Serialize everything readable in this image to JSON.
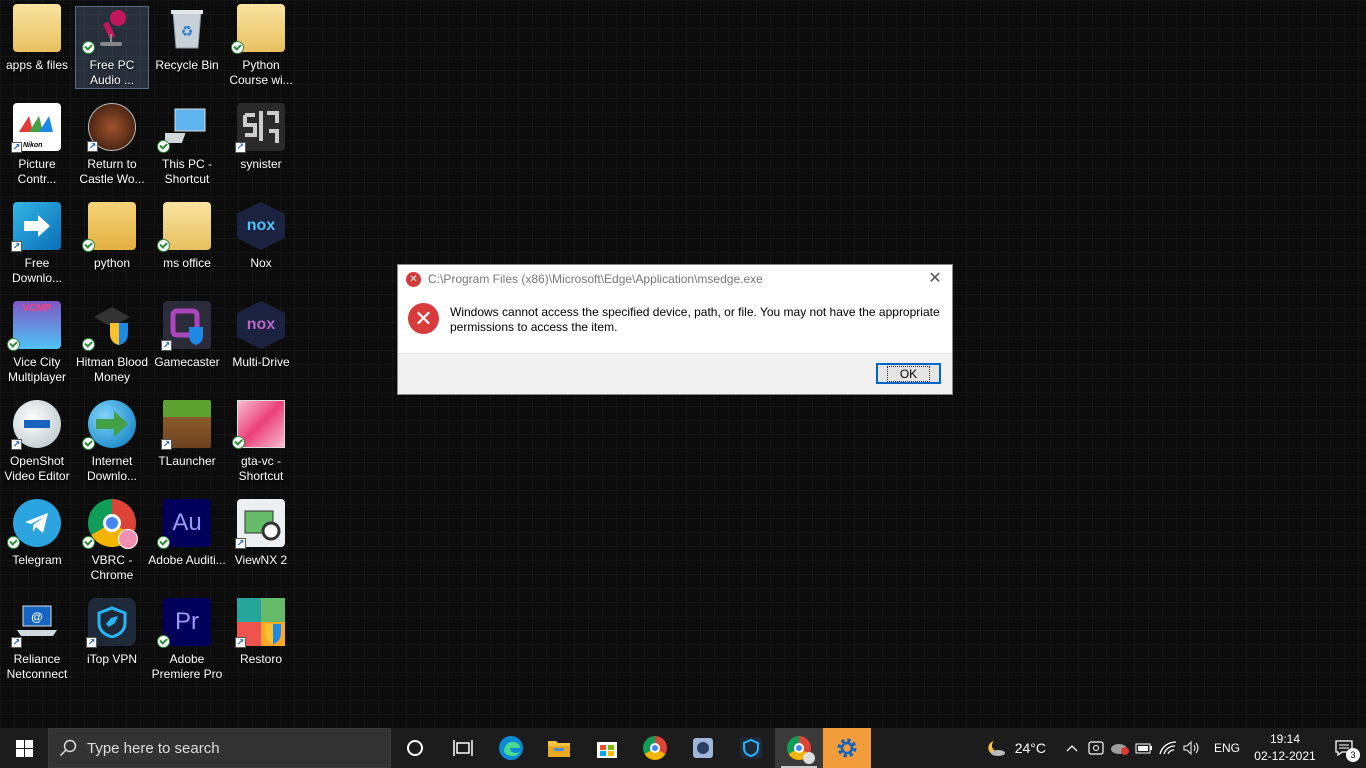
{
  "desktop": {
    "icons": [
      {
        "label": "apps & files",
        "icon": "folder-icon"
      },
      {
        "label": "Free PC Audio ...",
        "icon": "microphone-icon"
      },
      {
        "label": "Recycle Bin",
        "icon": "recycle-bin-icon"
      },
      {
        "label": "Python Course wi...",
        "icon": "folder-icon"
      },
      {
        "label": "Picture Contr...",
        "icon": "nikon-picture-control-icon"
      },
      {
        "label": "Return to Castle Wo...",
        "icon": "game-icon"
      },
      {
        "label": "This PC - Shortcut",
        "icon": "computer-icon"
      },
      {
        "label": "synister",
        "icon": "synister-icon"
      },
      {
        "label": "Free Downlo...",
        "icon": "download-arrow-icon"
      },
      {
        "label": "python",
        "icon": "folder-icon"
      },
      {
        "label": "ms office",
        "icon": "folder-icon"
      },
      {
        "label": "Nox",
        "icon": "nox-icon"
      },
      {
        "label": "Vice City Multiplayer",
        "icon": "vcmp-icon"
      },
      {
        "label": "Hitman Blood Money",
        "icon": "hitman-icon"
      },
      {
        "label": "Gamecaster",
        "icon": "gamecaster-icon"
      },
      {
        "label": "Multi-Drive",
        "icon": "nox-icon"
      },
      {
        "label": "OpenShot Video Editor",
        "icon": "openshot-icon"
      },
      {
        "label": "Internet Downlo...",
        "icon": "idm-globe-icon"
      },
      {
        "label": "TLauncher",
        "icon": "minecraft-block-icon"
      },
      {
        "label": "gta-vc - Shortcut",
        "icon": "image-thumbnail-icon"
      },
      {
        "label": "Telegram",
        "icon": "telegram-icon"
      },
      {
        "label": "VBRC - Chrome",
        "icon": "chrome-icon"
      },
      {
        "label": "Adobe Auditi...",
        "icon": "adobe-audition-icon"
      },
      {
        "label": "ViewNX 2",
        "icon": "viewnx-icon"
      },
      {
        "label": "Reliance Netconnect",
        "icon": "laptop-icon"
      },
      {
        "label": "iTop VPN",
        "icon": "vpn-shield-icon"
      },
      {
        "label": "Adobe Premiere Pro",
        "icon": "adobe-premiere-icon"
      },
      {
        "label": "Restoro",
        "icon": "restoro-icon"
      }
    ],
    "icon_text": {
      "au": "Au",
      "pr": "Pr",
      "nox": "nox",
      "vcmp": "VCMP",
      "nikon": "Nikon"
    }
  },
  "dialog": {
    "title": "C:\\Program Files (x86)\\Microsoft\\Edge\\Application\\msedge.exe",
    "message": "Windows cannot access the specified device, path, or file. You may not have the appropriate permissions to access the item.",
    "ok_label": "OK",
    "close_glyph": "✕",
    "error_glyph": "✕"
  },
  "taskbar": {
    "search_placeholder": "Type here to search",
    "apps": [
      "cortana",
      "task-view",
      "edge",
      "file-explorer",
      "microsoft-store",
      "chrome",
      "app",
      "vpn",
      "chrome-profile",
      "settings"
    ],
    "weather_temp": "24°C",
    "language": "ENG",
    "time": "19:14",
    "date": "02-12-2021",
    "notification_count": "3"
  },
  "colors": {
    "error_red": "#d83b3b",
    "ok_border": "#0064c8",
    "taskbar": "#1c1c1c",
    "settings_active": "#f39c3c"
  }
}
